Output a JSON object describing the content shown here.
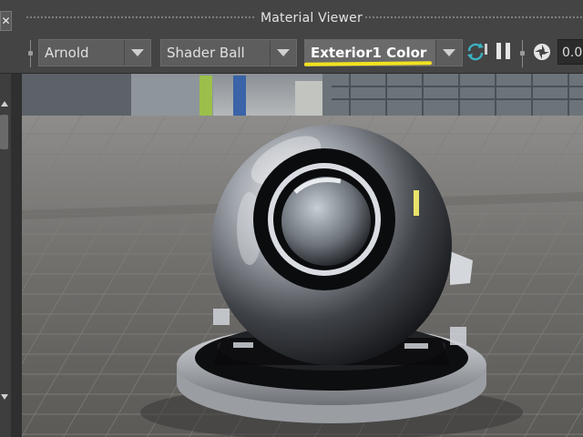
{
  "window": {
    "title": "Material Viewer",
    "close_glyph": "✕"
  },
  "toolbar": {
    "renderer": "Arnold",
    "geometry": "Shader Ball",
    "material": "Exterior1 Color",
    "value": "0.0"
  },
  "icons": {
    "refresh": "refresh-icon",
    "pause": "pause-icon",
    "aperture": "aperture-icon"
  },
  "colors": {
    "highlight": "#f2e21f",
    "panel": "#444444",
    "field": "#2b2b2b"
  }
}
